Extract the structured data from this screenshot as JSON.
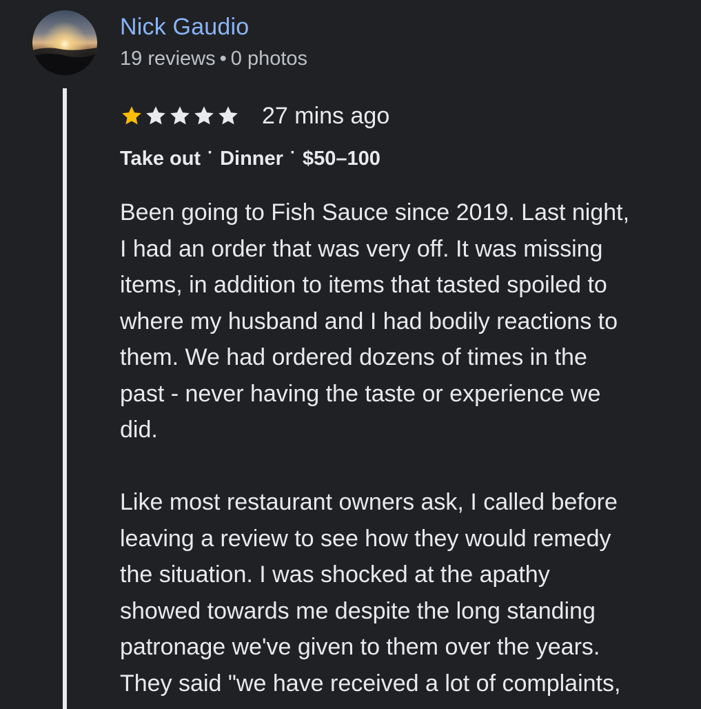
{
  "reviewer": {
    "name": "Nick Gaudio",
    "reviews_count": "19 reviews",
    "separator": "•",
    "photos_count": "0 photos"
  },
  "review": {
    "rating": 1,
    "max_rating": 5,
    "star_filled_color": "#fbbc04",
    "star_empty_color": "#e8eaed",
    "time_ago": "27 mins ago",
    "tags": {
      "service_type": "Take out",
      "meal_type": "Dinner",
      "price_range": "$50–100",
      "separator": "·"
    },
    "paragraphs": [
      "Been going to Fish Sauce since 2019. Last night,\nI had an order that was very off. It was missing\nitems, in addition to items that tasted spoiled to\nwhere my husband and I had bodily reactions to\nthem. We had ordered dozens of times in the\npast - never having the taste or experience we\ndid.",
      "Like most restaurant owners ask, I called before\nleaving a review to see how they would remedy\nthe situation. I was shocked at the apathy\nshowed towards me despite the long standing\npatronage we've given to them over the years.\nThey said \"we have received a lot of complaints,"
    ]
  },
  "colors": {
    "background": "#202124",
    "name_link": "#8ab4f8",
    "meta_text": "#bdc1c6",
    "body_text": "#e8eaed"
  },
  "icons": {
    "avatar": "sunset-over-clouds-photo",
    "star": "star-icon"
  }
}
